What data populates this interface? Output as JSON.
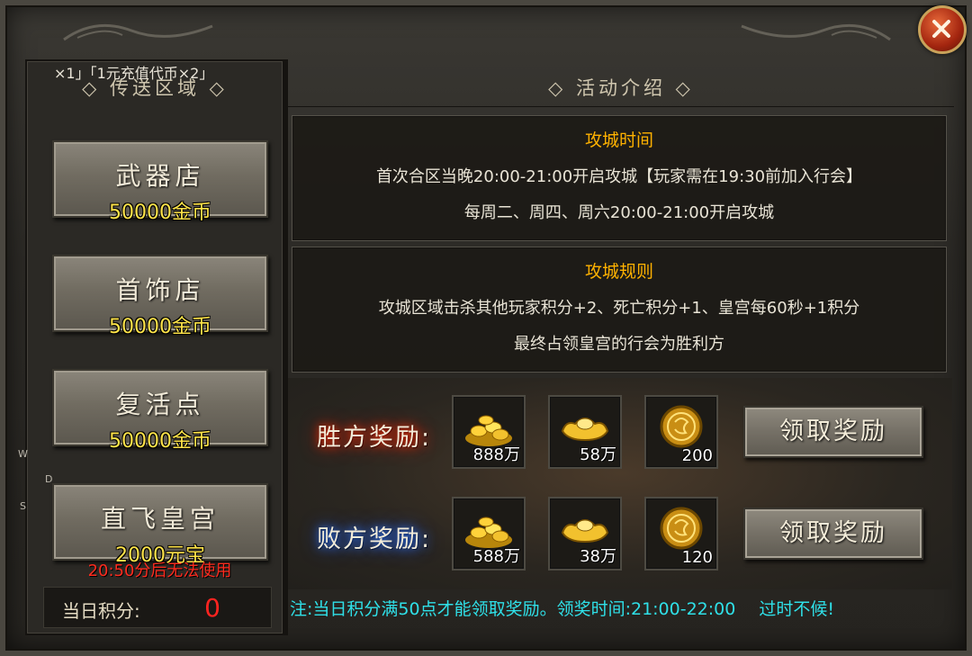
{
  "marquee": "×1」「1元充值代币×2」",
  "left_panel": {
    "title": "◇ 传送区域 ◇",
    "shops": [
      {
        "name": "武器店",
        "cost": "50000金币"
      },
      {
        "name": "首饰店",
        "cost": "50000金币"
      },
      {
        "name": "复活点",
        "cost": "50000金币"
      },
      {
        "name": "直飞皇宫",
        "cost": "2000元宝"
      }
    ],
    "warning": "20:50分后无法使用",
    "score_label": "当日积分:",
    "score_value": "0"
  },
  "right_panel": {
    "title": "◇ 活动介绍 ◇",
    "siege_time": {
      "title": "攻城时间",
      "lines": [
        "首次合区当晚20:00-21:00开启攻城【玩家需在19:30前加入行会】",
        "每周二、周四、周六20:00-21:00开启攻城"
      ]
    },
    "siege_rules": {
      "title": "攻城规则",
      "lines": [
        "攻城区域击杀其他玩家积分+2、死亡积分+1、皇宫每60秒+1积分",
        "最终占领皇宫的行会为胜利方"
      ]
    }
  },
  "rewards": {
    "win_label": "胜方奖励:",
    "lose_label": "败方奖励:",
    "win_items": [
      {
        "icon": "gold-pile-icon",
        "qty": "888万"
      },
      {
        "icon": "gold-ingot-icon",
        "qty": "58万"
      },
      {
        "icon": "coin-token-icon",
        "qty": "200"
      }
    ],
    "lose_items": [
      {
        "icon": "gold-pile-icon",
        "qty": "588万"
      },
      {
        "icon": "gold-ingot-icon",
        "qty": "38万"
      },
      {
        "icon": "coin-token-icon",
        "qty": "120"
      }
    ],
    "claim_label": "领取奖励"
  },
  "note": {
    "text": "注:当日积分满50点才能领取奖励。领奖时间:21:00-22:00",
    "late": "过时不候!"
  },
  "compass": [
    "W",
    "D",
    "S"
  ],
  "colors": {
    "gold": "#ffe44a",
    "warning": "#ff2b1e",
    "title_orange": "#ffb200",
    "note_cyan": "#2fe0e8",
    "win_glow": "#ff2a00",
    "lose_glow": "#2f7bff"
  }
}
